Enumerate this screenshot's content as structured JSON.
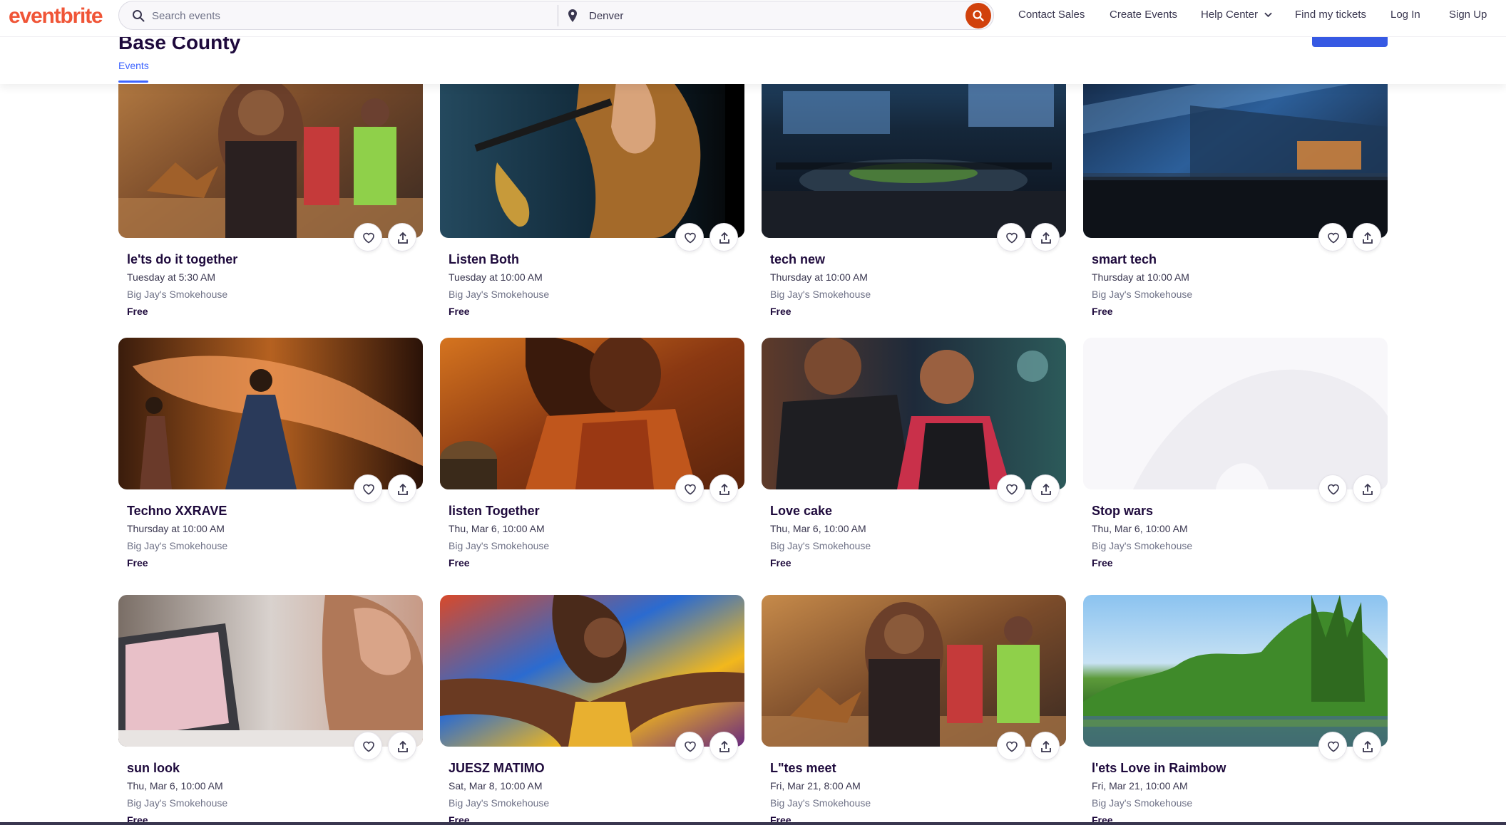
{
  "header": {
    "logo": "eventbrite",
    "search_placeholder": "Search events",
    "location_value": "Denver",
    "nav": {
      "contact_sales": "Contact Sales",
      "create_events": "Create Events",
      "help_center": "Help Center",
      "find_tickets": "Find my tickets",
      "log_in": "Log In",
      "sign_up": "Sign Up"
    }
  },
  "subheader": {
    "partial_title": "Base County",
    "tab_events": "Events"
  },
  "events": [
    {
      "title": "le'ts do it together",
      "date": "Tuesday at 5:30 AM",
      "venue": "Big Jay's Smokehouse",
      "price": "Free"
    },
    {
      "title": "Listen Both",
      "date": "Tuesday at 10:00 AM",
      "venue": "Big Jay's Smokehouse",
      "price": "Free"
    },
    {
      "title": "tech new",
      "date": "Thursday at 10:00 AM",
      "venue": "Big Jay's Smokehouse",
      "price": "Free"
    },
    {
      "title": "smart tech",
      "date": "Thursday at 10:00 AM",
      "venue": "Big Jay's Smokehouse",
      "price": "Free"
    },
    {
      "title": "Techno XXRAVE",
      "date": "Thursday at 10:00 AM",
      "venue": "Big Jay's Smokehouse",
      "price": "Free"
    },
    {
      "title": "listen Together",
      "date": "Thu, Mar 6, 10:00 AM",
      "venue": "Big Jay's Smokehouse",
      "price": "Free"
    },
    {
      "title": "Love cake",
      "date": "Thu, Mar 6, 10:00 AM",
      "venue": "Big Jay's Smokehouse",
      "price": "Free"
    },
    {
      "title": "Stop wars",
      "date": "Thu, Mar 6, 10:00 AM",
      "venue": "Big Jay's Smokehouse",
      "price": "Free"
    },
    {
      "title": "sun look",
      "date": "Thu, Mar 6, 10:00 AM",
      "venue": "Big Jay's Smokehouse",
      "price": "Free"
    },
    {
      "title": "JUESZ MATIMO",
      "date": "Sat, Mar 8, 10:00 AM",
      "venue": "Big Jay's Smokehouse",
      "price": "Free"
    },
    {
      "title": "L\"tes meet",
      "date": "Fri, Mar 21, 8:00 AM",
      "venue": "Big Jay's Smokehouse",
      "price": "Free"
    },
    {
      "title": "l'ets Love in Raimbow",
      "date": "Fri, Mar 21, 10:00 AM",
      "venue": "Big Jay's Smokehouse",
      "price": "Free"
    }
  ]
}
